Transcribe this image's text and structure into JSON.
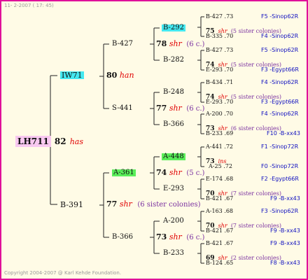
{
  "header": {
    "date": "11- 2-2007 ( 17: 45)"
  },
  "footer": {
    "copyright": "Copyright 2004-2007 @ Karl Kehde Foundation."
  },
  "colors": {
    "border": "#e0109a",
    "background": "#fffbe6",
    "race": "#e00000",
    "note": "#7a30a0",
    "ref": "#1010c0",
    "cyan": "#44e8f0",
    "green": "#5aee5a",
    "pink": "#f8c8f0"
  },
  "root": {
    "name": "LH711",
    "num": "82",
    "race": "has"
  },
  "gen1": [
    {
      "name": "IW71",
      "num": "80",
      "race": "han"
    },
    {
      "name": "B-391",
      "num": "77",
      "race": "shr",
      "note": "(6 sister colonies)"
    }
  ],
  "gen2": [
    {
      "name": "B-427",
      "num": "78",
      "race": "shr",
      "note": "(6 c.)"
    },
    {
      "name": "S-441",
      "num": "77",
      "race": "shr",
      "note": "(6 c.)"
    },
    {
      "name": "A-361",
      "num": "74",
      "race": "shr",
      "note": "(5 c.)"
    },
    {
      "name": "B-366",
      "num": "73",
      "race": "shr",
      "note": "(6 c.)"
    }
  ],
  "gen3": [
    {
      "name": "B-292"
    },
    {
      "name": "B-282"
    },
    {
      "name": "B-248"
    },
    {
      "name": "B-366"
    },
    {
      "name": "A-448"
    },
    {
      "name": "E-293"
    },
    {
      "name": "A-200"
    },
    {
      "name": "B-233"
    }
  ],
  "gen4": [
    {
      "top": {
        "name": "B-427",
        "val": ".73",
        "ref": "F5 -Sinop62R"
      },
      "num": "75",
      "race": "shr",
      "note": "(5 sister colonies)",
      "bottom": {
        "name": "B-335",
        "val": ".70",
        "ref": "F4 -Sinop62R"
      }
    },
    {
      "top": {
        "name": "B-427",
        "val": ".73",
        "ref": "F5 -Sinop62R"
      },
      "num": "74",
      "race": "shr",
      "note": "(5 sister colonies)",
      "bottom": {
        "name": "E-293",
        "val": ".70",
        "ref": "F3 -Egypt66R"
      }
    },
    {
      "top": {
        "name": "B-434",
        "val": ".71",
        "ref": "F4 -Sinop62R"
      },
      "num": "74",
      "race": "shr",
      "note": "(5 sister colonies)",
      "bottom": {
        "name": "E-293",
        "val": ".70",
        "ref": "F3 -Egypt66R"
      }
    },
    {
      "top": {
        "name": "A-200",
        "val": ".70",
        "ref": "F4 -Sinop62R"
      },
      "num": "73",
      "race": "shr",
      "note": "(6 sister colonies)",
      "bottom": {
        "name": "B-233",
        "val": ".69",
        "ref": "F10 -B-xx43"
      }
    },
    {
      "top": {
        "name": "A-441",
        "val": ".72",
        "ref": "F1 -Sinop72R"
      },
      "num": "73",
      "race": "ins",
      "note": "",
      "bottom": {
        "name": "A-25",
        "val": ".72",
        "ref": "F0 -Sinop72R"
      }
    },
    {
      "top": {
        "name": "E-174",
        "val": ".68",
        "ref": "F2 -Egypt66R"
      },
      "num": "70",
      "race": "shr",
      "note": "(7 sister colonies)",
      "bottom": {
        "name": "B-421",
        "val": ".67",
        "ref": "F9 -B-xx43"
      }
    },
    {
      "top": {
        "name": "A-163",
        "val": ".68",
        "ref": "F3 -Sinop62R"
      },
      "num": "70",
      "race": "shr",
      "note": "(7 sister colonies)",
      "bottom": {
        "name": "B-421",
        "val": ".67",
        "ref": "F9 -B-xx43"
      }
    },
    {
      "top": {
        "name": "B-421",
        "val": ".67",
        "ref": "F9 -B-xx43"
      },
      "num": "69",
      "race": "shr",
      "note": "(2 sister colonies)",
      "bottom": {
        "name": "B-124",
        "val": ".65",
        "ref": "F8 -B-xx43"
      }
    }
  ]
}
